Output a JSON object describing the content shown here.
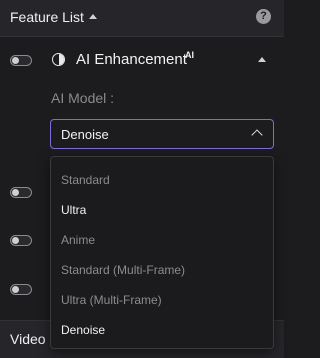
{
  "header": {
    "title": "Feature List",
    "help_icon": "question-circle-icon"
  },
  "feature": {
    "title": "AI Enhancement",
    "badge": "AI",
    "icon": "contrast-half-circle-icon",
    "model_label": "AI Model :",
    "selected_model": "Denoise"
  },
  "dropdown": {
    "options": [
      {
        "label": "Standard",
        "enabled": false
      },
      {
        "label": "Ultra",
        "enabled": true
      },
      {
        "label": "Anime",
        "enabled": false
      },
      {
        "label": "Standard (Multi-Frame)",
        "enabled": false
      },
      {
        "label": "Ultra (Multi-Frame)",
        "enabled": false
      },
      {
        "label": "Denoise",
        "enabled": true
      }
    ]
  },
  "collapsed_section": {
    "title": "Video S"
  },
  "colors": {
    "accent_border": "#7b6fd6",
    "background": "#1c1c1f",
    "panel": "#26262a"
  }
}
